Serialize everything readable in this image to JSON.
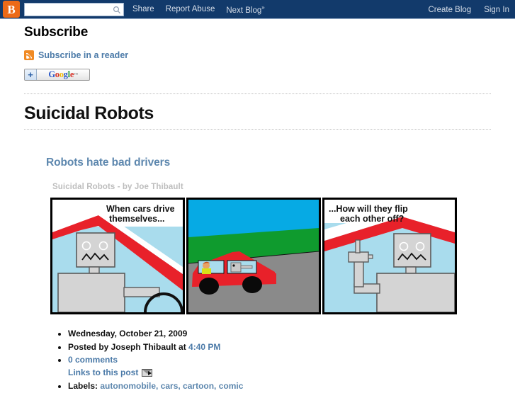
{
  "navbar": {
    "logo_letter": "B",
    "search_placeholder": "",
    "search_value": "",
    "links": [
      {
        "label": "Share"
      },
      {
        "label": "Report Abuse"
      },
      {
        "label": "Next Blog",
        "suffix": "»"
      }
    ],
    "right_links": [
      {
        "label": "Create Blog"
      },
      {
        "label": "Sign In"
      }
    ],
    "bg_color": "#123a6b",
    "logo_color": "#ec6a18"
  },
  "subscribe": {
    "heading": "Subscribe",
    "feed_link": "Subscribe in a reader",
    "google_button": {
      "plus": "+",
      "g": "G",
      "o1": "o",
      "o2": "o",
      "g2": "g",
      "l": "l",
      "e": "e",
      "tm": "™"
    }
  },
  "blog": {
    "title": "Suicidal Robots"
  },
  "post": {
    "title": "Robots hate bad drivers",
    "comic_caption": "Suicidal Robots - by Joe Thibault",
    "date": "Wednesday, October 21, 2009",
    "author_prefix": "Posted by Joseph Thibault at",
    "time": "4:40 PM",
    "comments": "0 comments",
    "links_to_post": "Links to this post",
    "labels_prefix": "Labels:",
    "labels": "autonomobile, cars, cartoon, comic"
  },
  "comic": {
    "panels": [
      {
        "id": "panel-1",
        "caption": "When cars drive\nthemselves...",
        "caption_line1": "When cars drive",
        "caption_line2": "themselves...",
        "scene": "robot-in-car-interior",
        "bg": "#a9dced",
        "roof": "#e8212a",
        "robot_body": "#d4d4d4"
      },
      {
        "id": "panel-2",
        "caption": "",
        "scene": "red-car-on-road",
        "sky": "#06aae4",
        "grass": "#0f9b2e",
        "road": "#8a8a8a",
        "car": "#e8212a"
      },
      {
        "id": "panel-3",
        "caption_line1": "...How will they flip",
        "caption_line2": "each other off?",
        "scene": "robot-with-arm",
        "bg": "#a9dced",
        "roof": "#e8212a",
        "robot_body": "#d4d4d4"
      }
    ]
  }
}
